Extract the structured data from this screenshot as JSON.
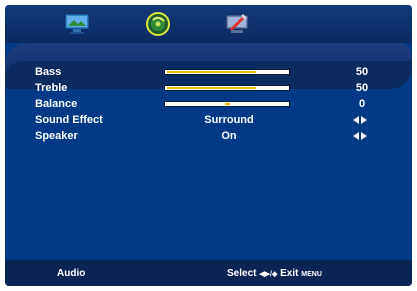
{
  "top_icons": [
    {
      "name": "picture-menu-icon",
      "selected": false
    },
    {
      "name": "audio-menu-icon",
      "selected": true
    },
    {
      "name": "setup-menu-icon",
      "selected": false
    }
  ],
  "menu": {
    "items": [
      {
        "label": "Bass",
        "type": "bar",
        "value": "50",
        "fill": 0.74
      },
      {
        "label": "Treble",
        "type": "bar",
        "value": "50",
        "fill": 0.74
      },
      {
        "label": "Balance",
        "type": "balance",
        "value": "0",
        "position": 0.5
      },
      {
        "label": "Sound Effect",
        "type": "select",
        "center_value": "Surround"
      },
      {
        "label": "Speaker",
        "type": "select",
        "center_value": "On"
      }
    ]
  },
  "bottom": {
    "title": "Audio",
    "select_label": "Select",
    "select_keys": "◀▶/◆",
    "exit_label": "Exit",
    "exit_key": "MENU"
  },
  "colors": {
    "background": "#003a86",
    "bar_fill": "#f2b800"
  }
}
